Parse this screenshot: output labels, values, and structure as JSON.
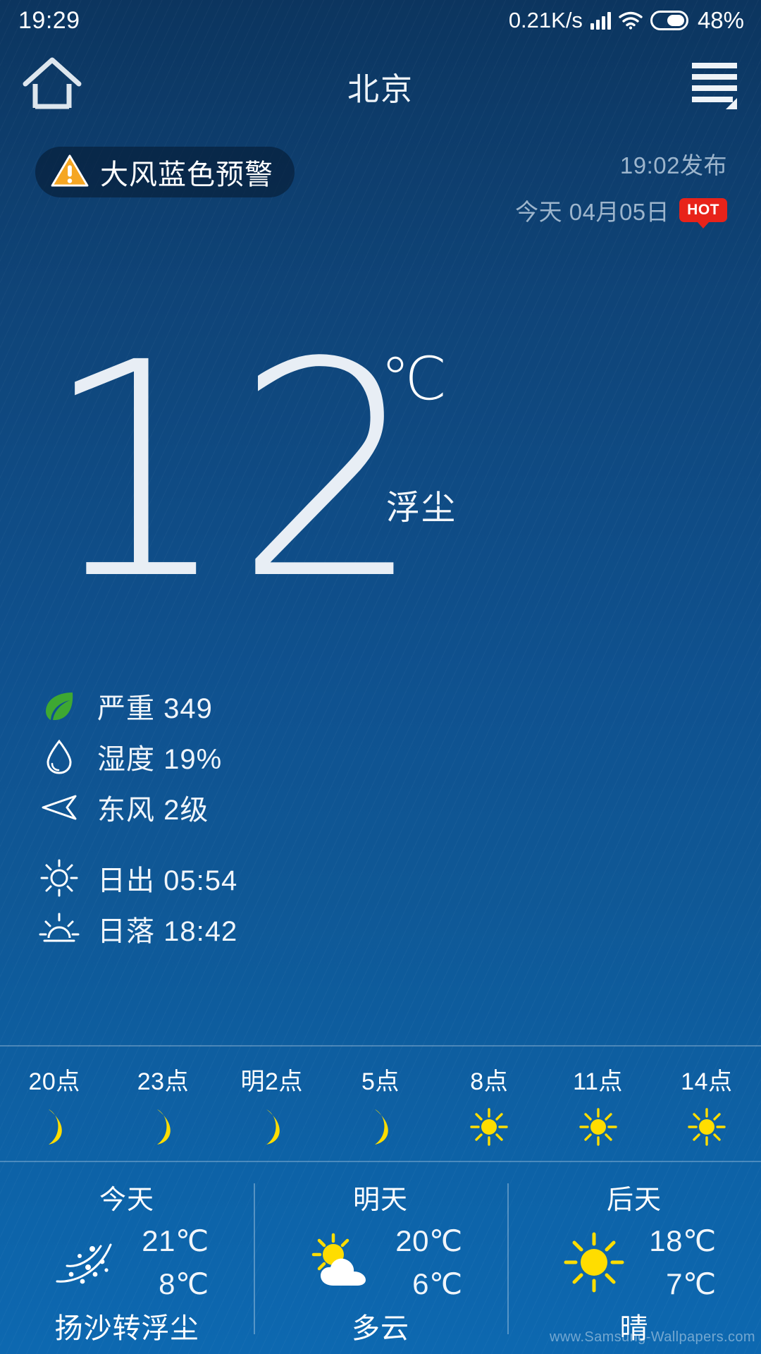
{
  "status_bar": {
    "time": "19:29",
    "network_speed": "0.21K/s",
    "battery_percent": "48%",
    "icons": [
      "signal-icon",
      "wifi-icon",
      "battery-icon"
    ]
  },
  "app_bar": {
    "home_icon": "home-icon",
    "city": "北京",
    "menu_icon": "menu-icon"
  },
  "alert": {
    "icon": "warning-triangle-icon",
    "label": "大风蓝色预警"
  },
  "publish": {
    "time": "19:02发布",
    "date": "今天 04月05日",
    "hot_badge": "HOT"
  },
  "current": {
    "temperature": "12",
    "unit": "℃",
    "condition": "浮尘"
  },
  "details": [
    {
      "icon": "leaf-icon",
      "text": "严重 349",
      "color": "#3ea832"
    },
    {
      "icon": "humidity-drop-icon",
      "text": "湿度 19%",
      "color": "#ffffff"
    },
    {
      "icon": "wind-arrow-icon",
      "text": "东风 2级",
      "color": "#ffffff"
    },
    {
      "icon": "sunrise-icon",
      "text": "日出  05:54",
      "color": "#ffffff"
    },
    {
      "icon": "sunset-icon",
      "text": "日落  18:42",
      "color": "#ffffff"
    }
  ],
  "hourly": [
    {
      "label": "20点",
      "icon": "moon-icon"
    },
    {
      "label": "23点",
      "icon": "moon-icon"
    },
    {
      "label": "明2点",
      "icon": "moon-icon"
    },
    {
      "label": "5点",
      "icon": "moon-icon"
    },
    {
      "label": "8点",
      "icon": "sun-icon"
    },
    {
      "label": "11点",
      "icon": "sun-icon"
    },
    {
      "label": "14点",
      "icon": "sun-icon"
    }
  ],
  "daily": [
    {
      "day": "今天",
      "icon": "dust-storm-icon",
      "high": "21℃",
      "low": "8℃",
      "desc": "扬沙转浮尘"
    },
    {
      "day": "明天",
      "icon": "sun-cloud-icon",
      "high": "20℃",
      "low": "6℃",
      "desc": "多云"
    },
    {
      "day": "后天",
      "icon": "sun-icon",
      "high": "18℃",
      "low": "7℃",
      "desc": "晴"
    }
  ],
  "watermark": "www.Samsung-Wallpapers.com",
  "colors": {
    "accent_yellow": "#ffdd00",
    "alert_orange": "#f5a623",
    "hot_red": "#e8231a",
    "leaf_green": "#3ea832",
    "muted_text": "#9db5cc"
  }
}
